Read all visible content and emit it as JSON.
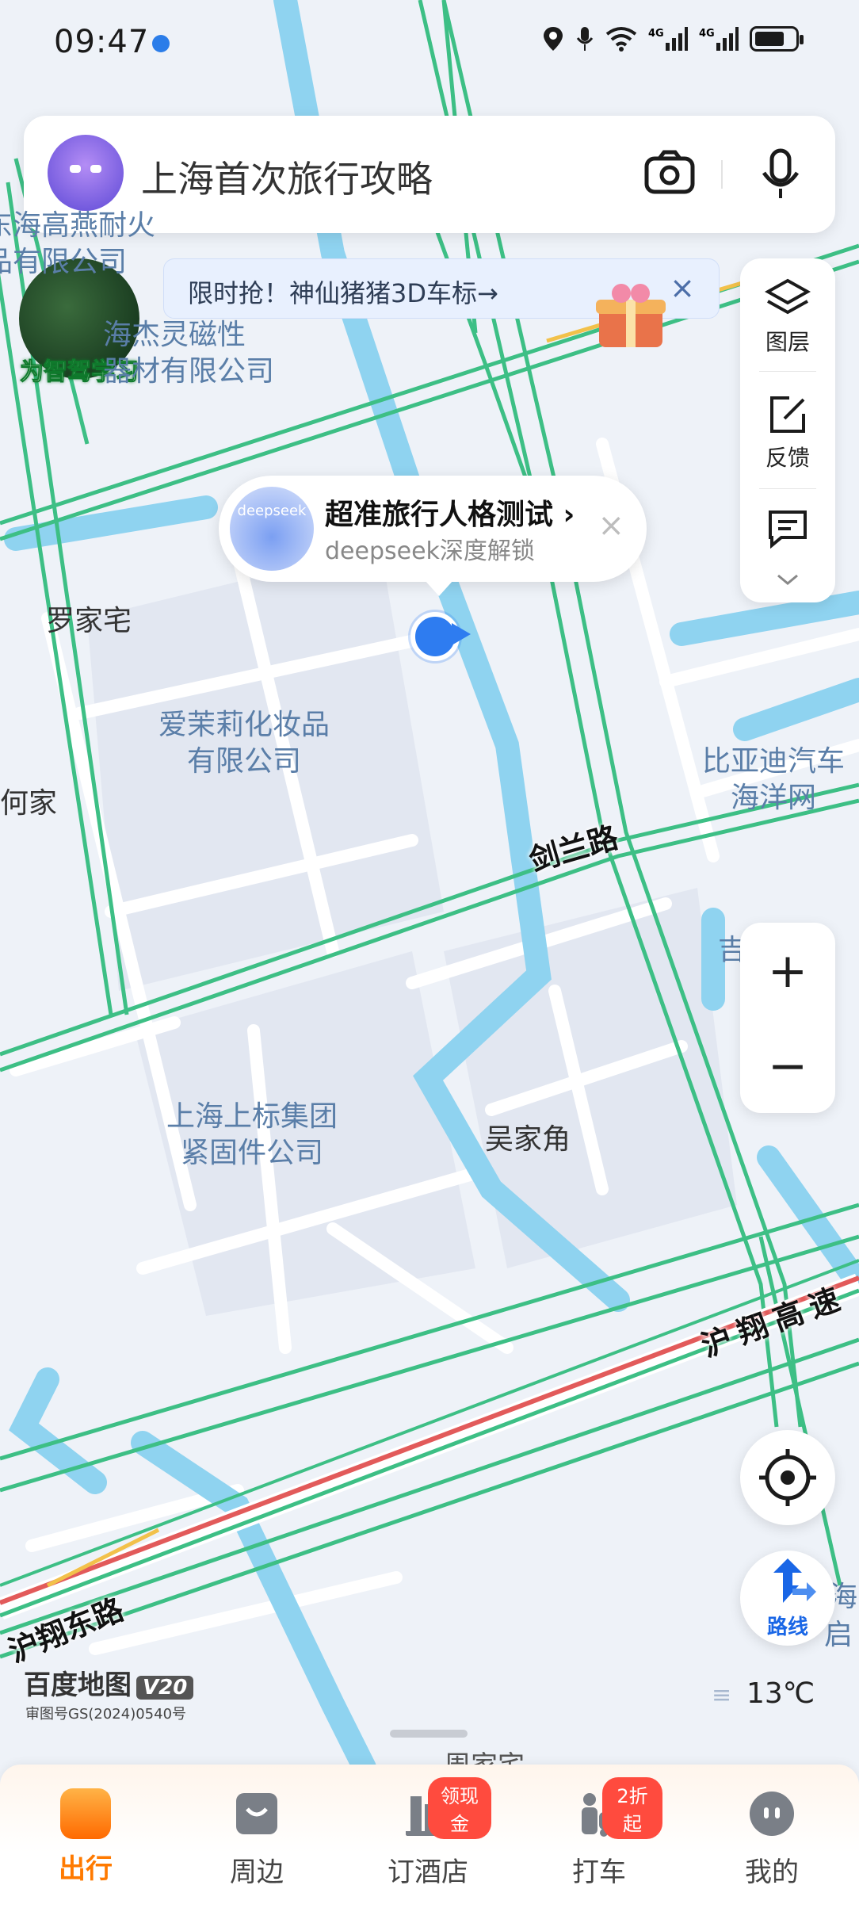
{
  "status_bar": {
    "time": "09:47",
    "icons": [
      "location-icon",
      "mic-icon",
      "wifi-icon",
      "4g-signal-icon",
      "4g-signal-icon",
      "battery-icon"
    ]
  },
  "search": {
    "placeholder": "上海首次旅行攻略"
  },
  "banner": {
    "text": "限时抢！神仙猪猪3D车标→",
    "close": "×"
  },
  "promo": {
    "label": "为智驾学习"
  },
  "tools": {
    "layers": "图层",
    "feedback": "反馈",
    "messages": ""
  },
  "popup": {
    "logo_text": "deepseek",
    "title": "超准旅行人格测试 ›",
    "subtitle": "deepseek深度解锁",
    "close": "×"
  },
  "places": {
    "luojiazhai": "罗家宅",
    "aimoli_1": "爱茉莉化妆品",
    "aimoli_2": "有限公司",
    "jiejing_1": "海杰灵磁性",
    "jiejing_2": "器材有限公司",
    "topleft_1": "东海高燕耐火",
    "topleft_2": "品有限公司",
    "hejia": "何家",
    "byd_1": "比亚迪汽车",
    "byd_2": "海洋网",
    "shangbiao_1": "上海上标集团",
    "shangbiao_2": "紧固件公司",
    "wujiajiao": "吴家角",
    "right_partial": "吉…",
    "right_partial2": "海",
    "right_partial3": "启"
  },
  "roads": {
    "jianlan": "剑兰路",
    "huxiang_expressway": "沪翔高速",
    "huxiang_east": "沪翔东路"
  },
  "zoom": {
    "plus": "+",
    "minus": "−"
  },
  "route_button": {
    "label": "路线"
  },
  "brand": {
    "name": "百度地图",
    "version": "V20",
    "approval": "审图号GS(2024)0540号"
  },
  "weather": {
    "temp": "13℃"
  },
  "bottom_partial_label": "周家宅",
  "tabs": [
    {
      "label": "出行",
      "active": true,
      "badge": ""
    },
    {
      "label": "周边",
      "active": false,
      "badge": ""
    },
    {
      "label": "订酒店",
      "active": false,
      "badge": "领现金"
    },
    {
      "label": "打车",
      "active": false,
      "badge": "2折起"
    },
    {
      "label": "我的",
      "active": false,
      "badge": ""
    }
  ],
  "colors": {
    "accent_blue": "#2e7cf0",
    "road_green": "#3dbf85",
    "water": "#8fd3f0",
    "expressway_red": "#e25a5a",
    "active_tab": "#ff7a00"
  }
}
